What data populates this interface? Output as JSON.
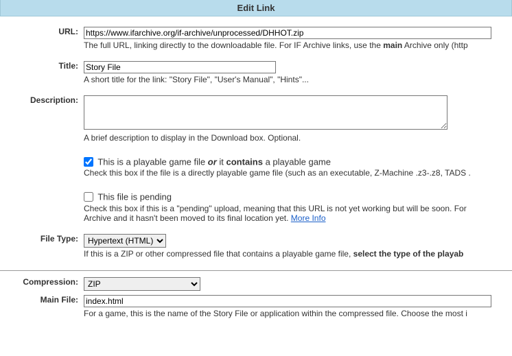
{
  "header": {
    "title": "Edit Link"
  },
  "url": {
    "label": "URL:",
    "value": "https://www.ifarchive.org/if-archive/unprocessed/DHHOT.zip",
    "hint_pre": "The full URL, linking directly to the downloadable file. For IF Archive links, use the ",
    "hint_bold": "main",
    "hint_post": " Archive only (http"
  },
  "title": {
    "label": "Title:",
    "value": "Story File",
    "hint": "A short title for the link: \"Story File\", \"User's Manual\", \"Hints\"..."
  },
  "description": {
    "label": "Description:",
    "value": "",
    "hint": "A brief description to display in the Download box. Optional."
  },
  "playable": {
    "label_pre": "This is a playable game file ",
    "label_or": "or",
    "label_mid": " it ",
    "label_contains": "contains",
    "label_post": " a playable game",
    "checked": true,
    "hint": "Check this box if the file is a directly playable game file (such as an executable, Z-Machine .z3-.z8, TADS ."
  },
  "pending": {
    "label": "This file is pending",
    "checked": false,
    "hint_pre": "Check this box if this is a \"pending\" upload, meaning that this URL is not yet working but will be soon. For",
    "hint_post": "Archive and it hasn't been moved to its final location yet. ",
    "more_info": "More Info"
  },
  "file_type": {
    "label": "File Type:",
    "value": "Hypertext (HTML)",
    "hint_pre": "If this is a ZIP or other compressed file that contains a playable game file, ",
    "hint_bold": "select the type of the playab"
  },
  "compression": {
    "label": "Compression:",
    "value": "ZIP"
  },
  "main_file": {
    "label": "Main File:",
    "value": "index.html",
    "hint": "For a game, this is the name of the Story File or application within the compressed file. Choose the most i"
  }
}
